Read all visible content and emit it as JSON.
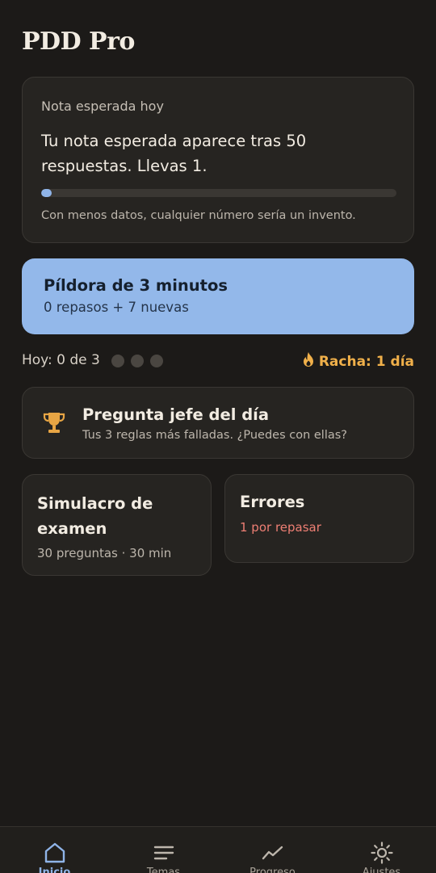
{
  "app": {
    "title": "PDD Pro"
  },
  "grade": {
    "label": "Nota esperada hoy",
    "message": "Tu nota esperada aparece tras 50 respuestas. Llevas 1.",
    "progress": 0.02,
    "note": "Con menos datos, cualquier número sería un invento."
  },
  "pill": {
    "title": "Píldora de 3 minutos",
    "subtitle": "0 repasos + 7 nuevas"
  },
  "today": {
    "text": "Hoy: 0 de 3",
    "completed": 0,
    "total": 3
  },
  "streak": {
    "text": "Racha: 1 día",
    "icon": "flame-icon",
    "color": "#f0b04a"
  },
  "boss": {
    "title": "Pregunta jefe del día",
    "subtitle": "Tus 3 reglas más falladas. ¿Puedes con ellas?",
    "icon": "trophy-icon"
  },
  "exam": {
    "title": "Simulacro de examen",
    "subtitle": "30 preguntas · 30 min"
  },
  "errors": {
    "title": "Errores",
    "subtitle": "1 por repasar",
    "color": "#ee7f74"
  },
  "nav": {
    "items": [
      {
        "label": "Inicio",
        "icon": "home-icon",
        "active": true
      },
      {
        "label": "Temas",
        "icon": "list-icon",
        "active": false
      },
      {
        "label": "Progreso",
        "icon": "trend-icon",
        "active": false
      },
      {
        "label": "Ajustes",
        "icon": "sun-icon",
        "active": false
      }
    ]
  },
  "colors": {
    "accent": "#8fb4e8",
    "background": "#1c1a18",
    "card": "#262421"
  }
}
